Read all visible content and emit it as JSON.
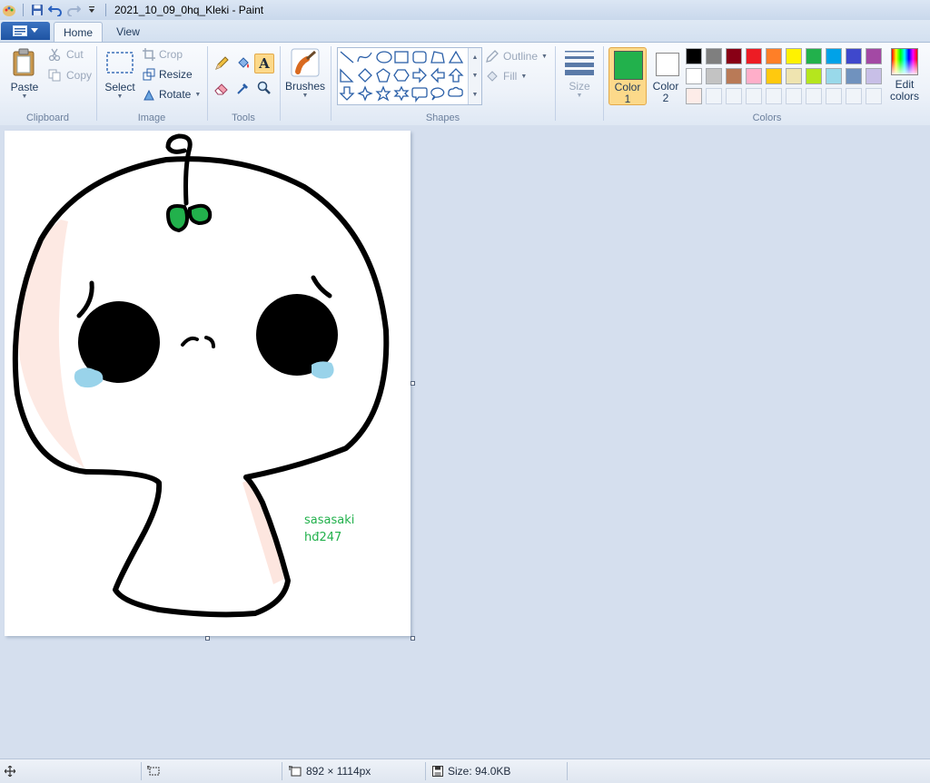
{
  "window": {
    "title": "2021_10_09_0hq_Kleki - Paint"
  },
  "tabs": [
    {
      "label": "Home"
    },
    {
      "label": "View"
    }
  ],
  "clipboard": {
    "paste": "Paste",
    "cut": "Cut",
    "copy": "Copy",
    "group_label": "Clipboard"
  },
  "image": {
    "select": "Select",
    "crop": "Crop",
    "resize": "Resize",
    "rotate": "Rotate",
    "group_label": "Image"
  },
  "tools": {
    "group_label": "Tools",
    "selected_tool": "text"
  },
  "brushes": {
    "label": "Brushes"
  },
  "shapes": {
    "outline": "Outline",
    "fill": "Fill",
    "group_label": "Shapes"
  },
  "size": {
    "label": "Size"
  },
  "colors": {
    "color1_label": "Color",
    "color1_num": "1",
    "color2_label": "Color",
    "color2_num": "2",
    "edit_label_1": "Edit",
    "edit_label_2": "colors",
    "group_label": "Colors",
    "color1_value": "#22b14c",
    "color2_value": "#ffffff",
    "palette_row1": [
      "#000000",
      "#7f7f7f",
      "#880015",
      "#ed1c24",
      "#ff7f27",
      "#fff200",
      "#22b14c",
      "#00a2e8",
      "#3f48cc",
      "#a349a4"
    ],
    "palette_row2": [
      "#ffffff",
      "#c3c3c3",
      "#b97a57",
      "#ffaec9",
      "#ffc90e",
      "#efe4b0",
      "#b5e61d",
      "#99d9ea",
      "#7092be",
      "#c8bfe7"
    ],
    "palette_row3": [
      "#fdece8",
      "#f0f4f9",
      "#f0f4f9",
      "#f0f4f9",
      "#f0f4f9",
      "#f0f4f9",
      "#f0f4f9",
      "#f0f4f9",
      "#f0f4f9",
      "#f0f4f9"
    ]
  },
  "canvas": {
    "signature_line1": "sasasaki",
    "signature_line2": "hđ247"
  },
  "status": {
    "selection_size": "",
    "image_dimensions": "892 × 1114px",
    "file_size": "Size: 94.0KB"
  }
}
